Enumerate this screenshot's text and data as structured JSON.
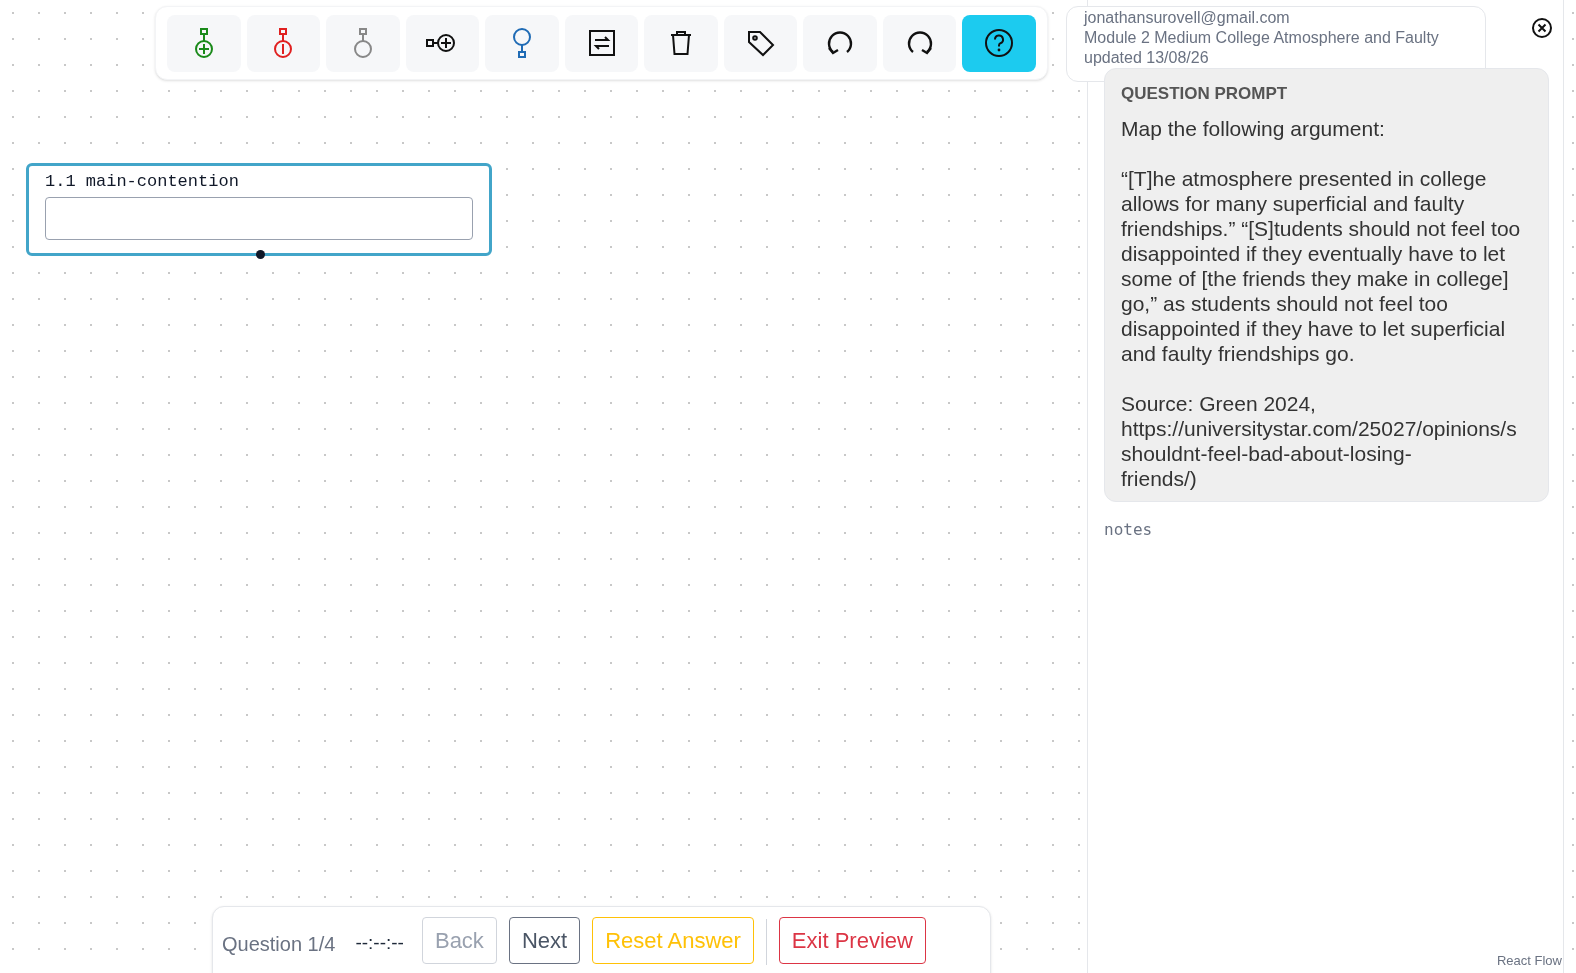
{
  "toolbar": {
    "buttons": [
      {
        "kind": "add-support",
        "selected": false
      },
      {
        "kind": "add-objection",
        "selected": false
      },
      {
        "kind": "add-premise",
        "selected": false
      },
      {
        "kind": "add-co-premise",
        "selected": false
      },
      {
        "kind": "add-parent",
        "selected": false
      },
      {
        "kind": "swap",
        "selected": false
      },
      {
        "kind": "delete",
        "selected": false
      },
      {
        "kind": "tag",
        "selected": false
      },
      {
        "kind": "undo",
        "selected": false
      },
      {
        "kind": "redo",
        "selected": false
      },
      {
        "kind": "help",
        "selected": true
      }
    ]
  },
  "node": {
    "label": "1.1 main-contention"
  },
  "info_card": {
    "email": "jonathansurovell@gmail.com",
    "module": "Module 2 Medium College Atmosphere and Faulty",
    "updated": "updated 13/08/26"
  },
  "panel": {
    "heading": "QUESTION PROMPT",
    "paragraphs": [
      "Map the following argument:",
      "“[T]he atmosphere presented in college allows for many superficial and faulty friendships.” “[S]tudents should not feel too disappointed if they eventually have to let some of [the friends they make in college] go,” as students should not feel too disappointed if they have to let superficial and faulty friendships go."
    ],
    "source_lines": [
      "Source: Green 2024,",
      "https://universitystar.com/25027/opinions/s",
      "shouldnt-feel-bad-about-losing-",
      "friends/)"
    ],
    "notes": {
      "placeholder": "notes"
    }
  },
  "footer": {
    "question": "Question 1/4",
    "timer": "--:--:--",
    "buttons": [
      {
        "label": "Back",
        "kind": "secondary",
        "disabled": true
      },
      {
        "label": "Next",
        "kind": "secondary",
        "disabled": false
      },
      {
        "label": "Reset Answer",
        "kind": "warning",
        "disabled": false
      },
      {
        "label": "Exit Preview",
        "kind": "danger",
        "disabled": false
      }
    ]
  },
  "attribution": "React Flow"
}
